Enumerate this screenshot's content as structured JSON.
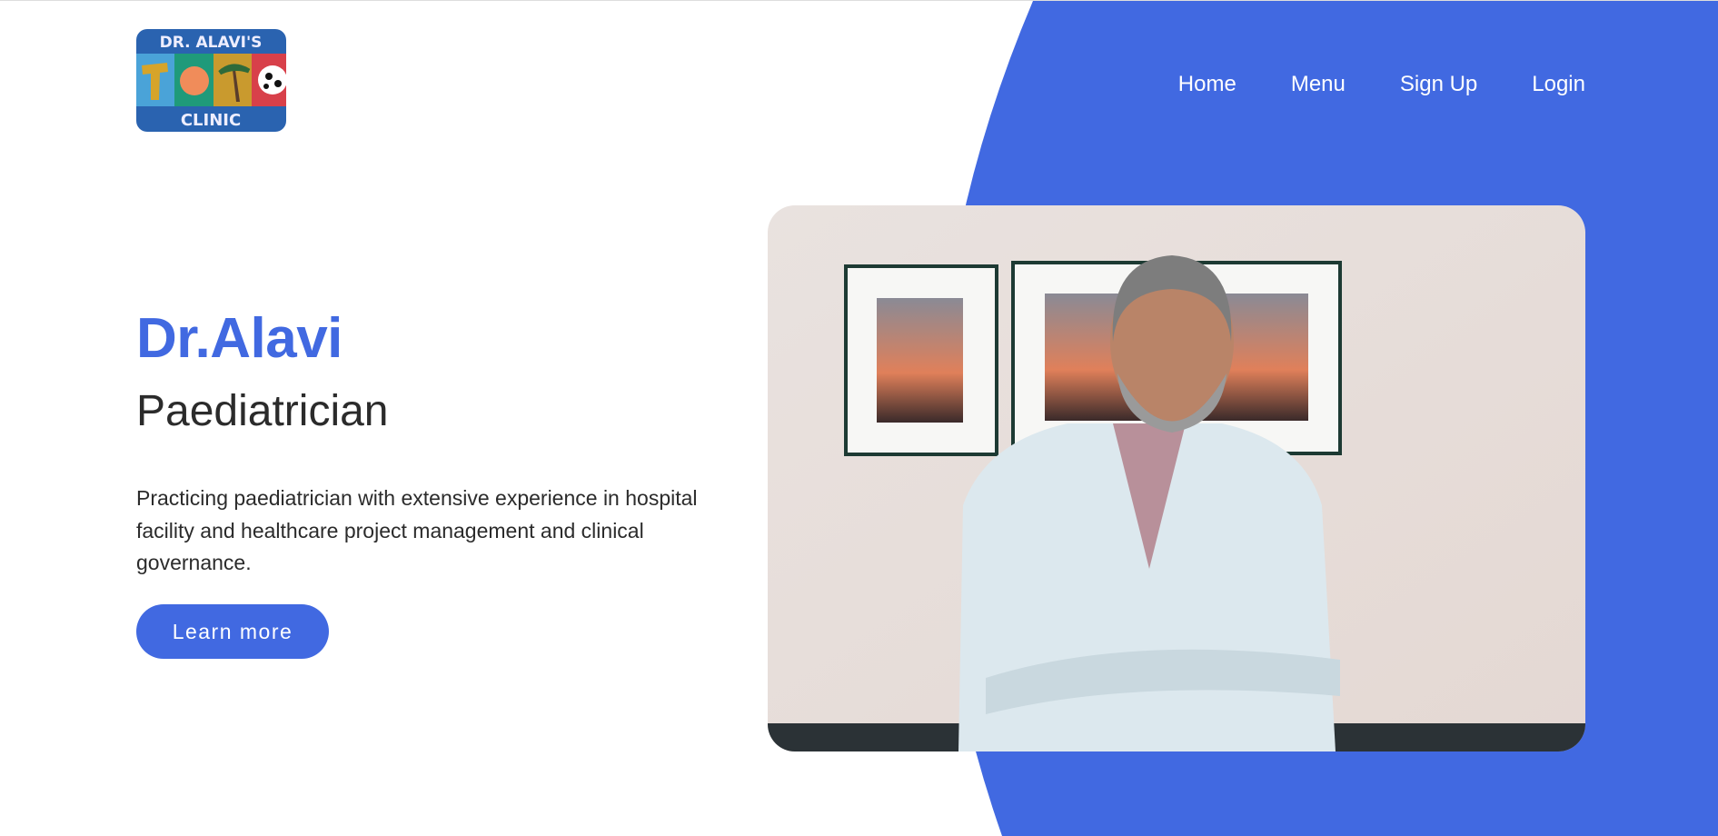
{
  "colors": {
    "accent": "#4169e1",
    "text": "#2b2b2b"
  },
  "logo": {
    "text_top": "DR. ALAVI'S",
    "text_middle": "TOTO",
    "text_bottom": "CLINIC"
  },
  "nav": {
    "items": [
      {
        "label": "Home"
      },
      {
        "label": "Menu"
      },
      {
        "label": "Sign Up"
      },
      {
        "label": "Login"
      }
    ]
  },
  "hero": {
    "title": "Dr.Alavi",
    "subtitle": "Paediatrician",
    "description": "Practicing paediatrician with extensive experience in hospital facility and healthcare project management and clinical governance.",
    "cta_label": "Learn more"
  },
  "photo": {
    "subject": "doctor-portrait"
  }
}
